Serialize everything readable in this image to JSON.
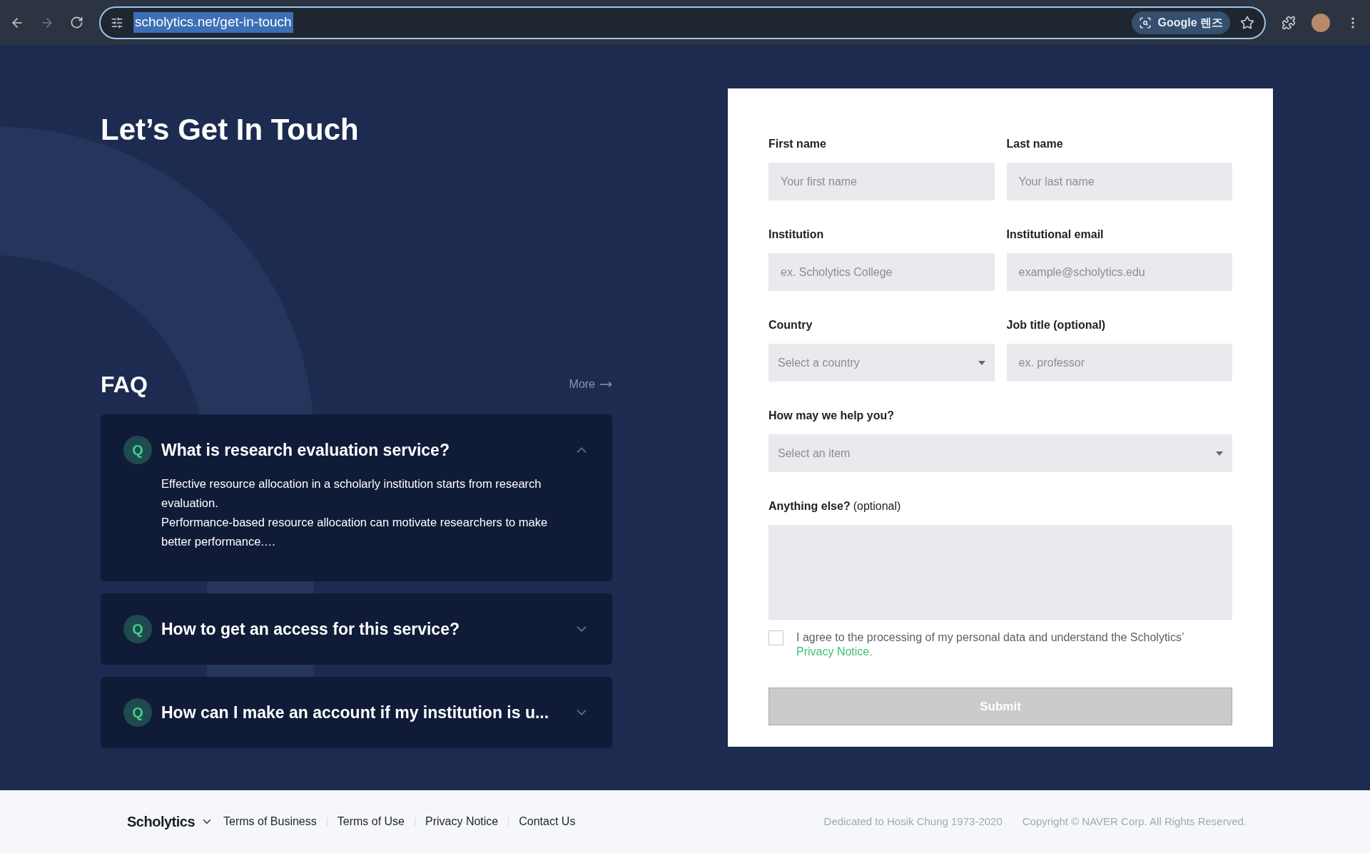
{
  "browser": {
    "url": "scholytics.net/get-in-touch",
    "lens_label": "Google 렌즈"
  },
  "heading": "Let’s Get In Touch",
  "faq": {
    "title": "FAQ",
    "more": "More",
    "items": [
      {
        "badge": "Q",
        "question": "What is research evaluation service?",
        "expanded": true,
        "answer": [
          "Effective resource allocation in a scholarly institution starts from research evaluation.",
          "Performance-based resource allocation can motivate researchers to make better performance.…"
        ]
      },
      {
        "badge": "Q",
        "question": "How to get an access for this service?",
        "expanded": false
      },
      {
        "badge": "Q",
        "question": "How can I make an account if my institution is u...",
        "expanded": false
      }
    ]
  },
  "form": {
    "rows": [
      [
        {
          "label": "First name",
          "kind": "text",
          "placeholder": "Your first name"
        },
        {
          "label": "Last name",
          "kind": "text",
          "placeholder": "Your last name"
        }
      ],
      [
        {
          "label": "Institution",
          "kind": "text",
          "placeholder": "ex. Scholytics College"
        },
        {
          "label": "Institutional email",
          "kind": "text",
          "placeholder": "example@scholytics.edu"
        }
      ],
      [
        {
          "label": "Country",
          "kind": "select",
          "placeholder": "Select a country"
        },
        {
          "label": "Job title (optional)",
          "kind": "text",
          "placeholder": "ex. professor"
        }
      ],
      [
        {
          "label": "How may we help you?",
          "kind": "select",
          "placeholder": "Select an item"
        }
      ]
    ],
    "message": {
      "label": "Anything else?",
      "note": "(optional)"
    },
    "consent": {
      "checked": false,
      "text": "I agree to the processing of my personal data and understand the Scholytics’",
      "link": "Privacy Notice."
    },
    "submit": {
      "label": "Submit",
      "disabled": true
    }
  },
  "footer": {
    "brand": "Scholytics",
    "links": [
      "Terms of Business",
      "Terms of Use",
      "Privacy Notice",
      "Contact Us"
    ],
    "dedication": "Dedicated to Hosik Chung 1973-2020",
    "copyright": "Copyright © NAVER Corp. All Rights Reserved."
  }
}
